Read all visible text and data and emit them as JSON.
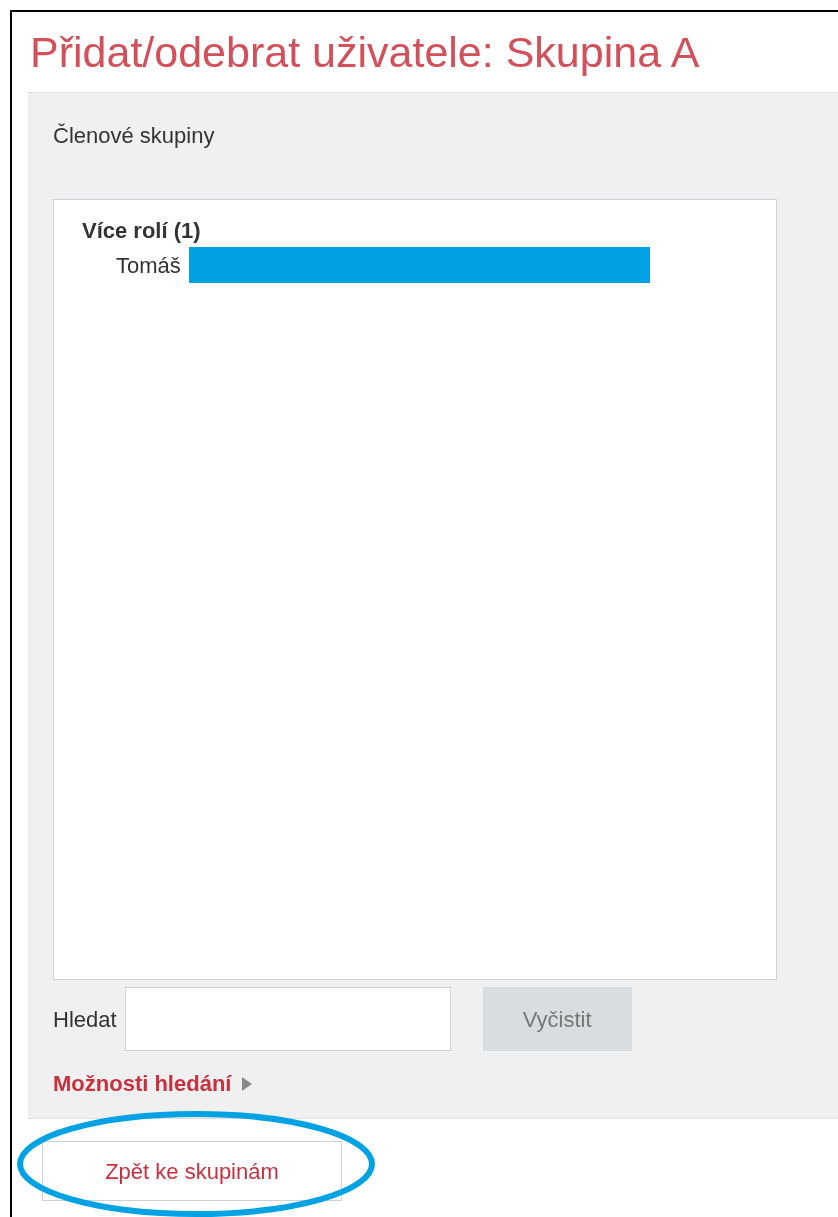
{
  "title": "Přidat/odebrat uživatele: Skupina A",
  "section_label": "Členové skupiny",
  "listbox": {
    "groups": [
      {
        "label": "Více rolí (1)",
        "options": [
          {
            "text": "Tomáš",
            "selected": false,
            "redacted": true
          }
        ]
      }
    ]
  },
  "search": {
    "label": "Hledat"
  },
  "clear_button": {
    "label": "Vyčistit",
    "disabled": true
  },
  "options_link": {
    "label": "Možnosti hledání",
    "expanded": false
  },
  "back_button": {
    "label": "Zpět ke skupinám",
    "highlighted": true
  }
}
